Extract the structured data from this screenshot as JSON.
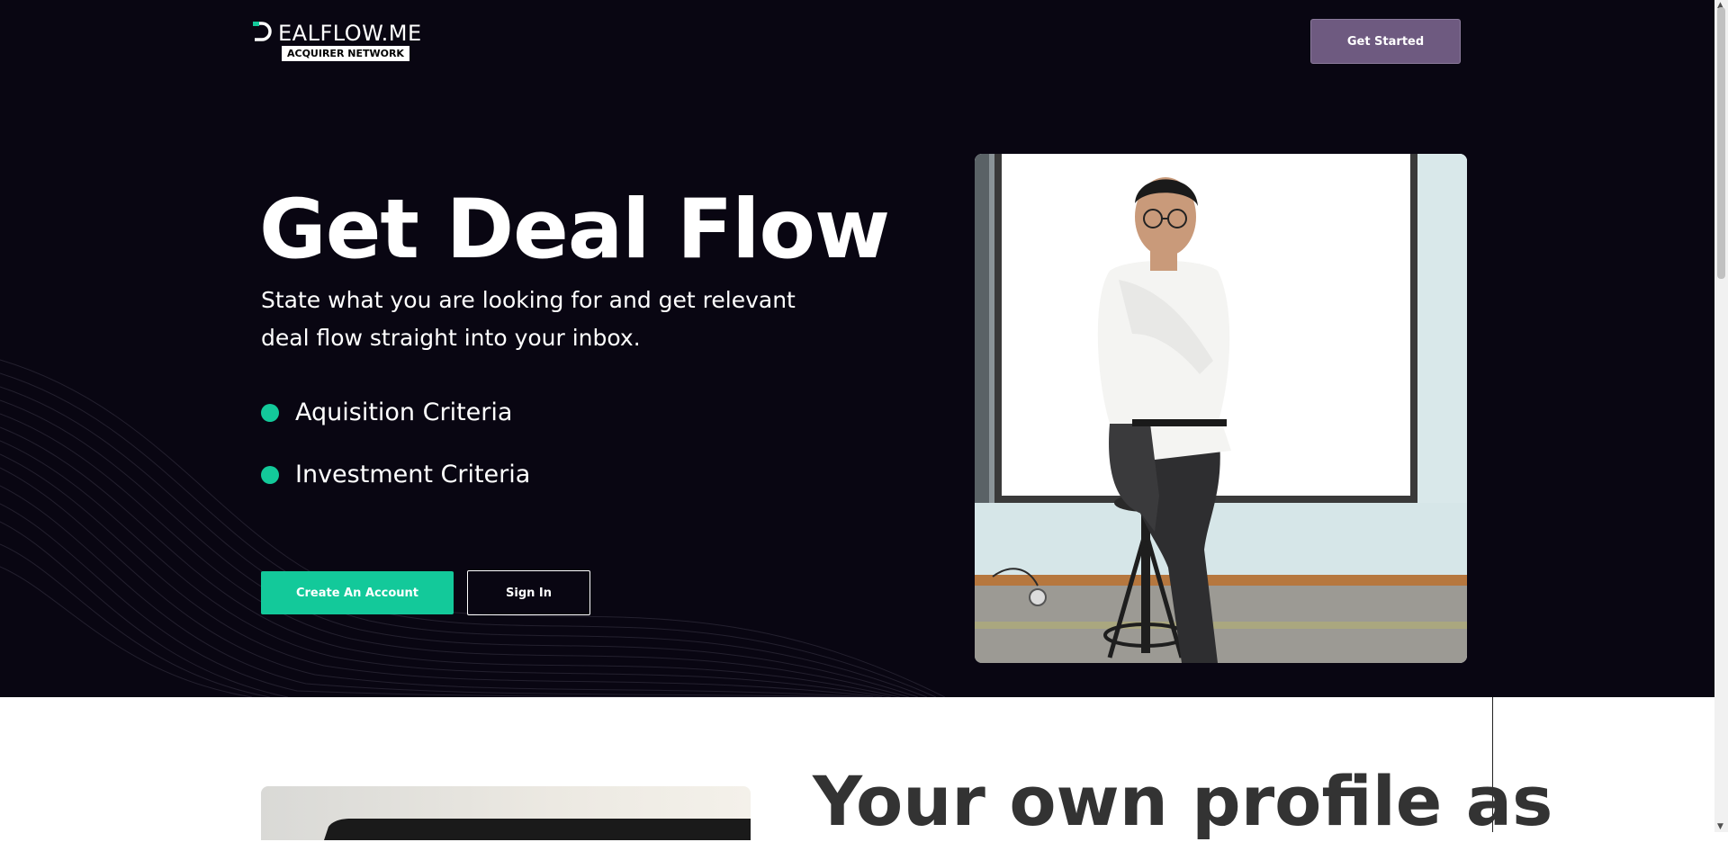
{
  "header": {
    "logo_text": "EALFLOW.ME",
    "logo_subtitle": "ACQUIRER NETWORK",
    "get_started_label": "Get Started"
  },
  "hero": {
    "headline": "Get Deal Flow",
    "subline": "State what you are looking for and get relevant deal flow straight into your inbox.",
    "criteria": [
      {
        "label": "Aquisition Criteria"
      },
      {
        "label": "Investment Criteria"
      }
    ],
    "create_account_label": "Create An Account",
    "sign_in_label": "Sign In"
  },
  "section2": {
    "title": "Your own profile as"
  },
  "colors": {
    "hero_bg": "#090612",
    "accent_green": "#13c99a",
    "button_purple": "#6e5a80"
  },
  "icons": {
    "logo": "dealflow-d-logo",
    "bullet": "green-dot-icon"
  }
}
